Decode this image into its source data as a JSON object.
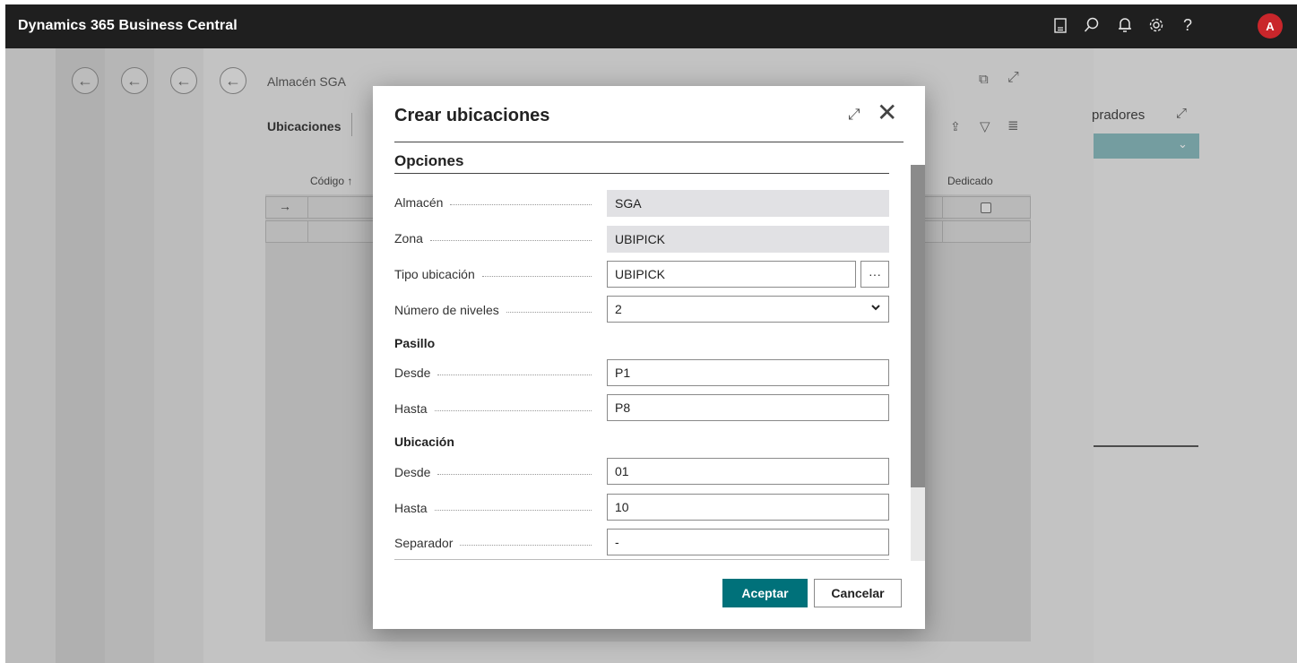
{
  "app": {
    "title": "Dynamics 365 Business Central",
    "icons": [
      "document-icon",
      "search-icon",
      "bell-icon",
      "gear-icon",
      "help-icon"
    ],
    "avatar_initial": "A"
  },
  "background_page": {
    "title": "Almacén SGA",
    "tab": "Ubicaciones",
    "columns": {
      "code": "Código ↑",
      "dedicated": "Dedicado"
    },
    "row_arrow": "→",
    "right_panel_label": "pradores"
  },
  "modal": {
    "title": "Crear ubicaciones",
    "section": "Opciones",
    "fields": {
      "almacen": {
        "label": "Almacén",
        "value": "SGA"
      },
      "zona": {
        "label": "Zona",
        "value": "UBIPICK"
      },
      "tipo_ubicacion": {
        "label": "Tipo ubicación",
        "value": "UBIPICK",
        "button": "···"
      },
      "numero_niveles": {
        "label": "Número de niveles",
        "value": "2"
      }
    },
    "pasillo": {
      "label": "Pasillo",
      "desde": {
        "label": "Desde",
        "value": "P1"
      },
      "hasta": {
        "label": "Hasta",
        "value": "P8"
      }
    },
    "ubicacion": {
      "label": "Ubicación",
      "desde": {
        "label": "Desde",
        "value": "01"
      },
      "hasta": {
        "label": "Hasta",
        "value": "10"
      },
      "separador": {
        "label": "Separador",
        "value": "-"
      }
    },
    "buttons": {
      "ok": "Aceptar",
      "cancel": "Cancelar"
    }
  },
  "colors": {
    "topbar": "#1f1f1f",
    "accent": "#00717a",
    "avatar": "#c9262b"
  }
}
